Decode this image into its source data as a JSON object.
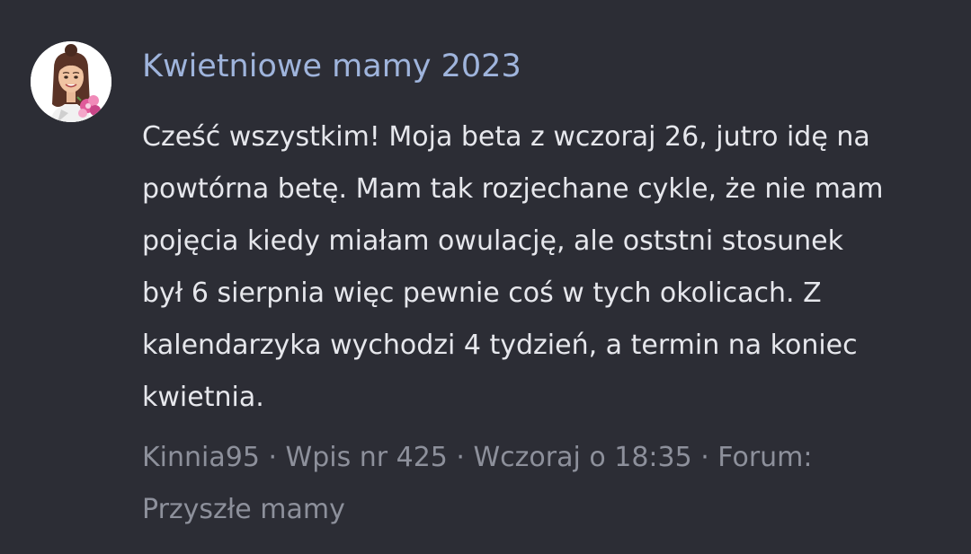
{
  "post": {
    "avatar_icon": "bitmoji-avatar-icon",
    "group_title": "Kwietniowe mamy 2023",
    "body_lines": [
      "Cześć wszystkim! Moja beta z wczoraj 26, jutro idę na",
      "powtórna betę. Mam tak rozjechane cykle, że nie mam",
      "pojęcia kiedy miałam owulację, ale oststni stosunek",
      "był 6 sierpnia więc pewnie coś w tych okolicach. Z",
      "kalendarzyka wychodzi 4 tydzień, a termin na koniec",
      "kwietnia."
    ],
    "meta_lines": [
      "Kinnia95 · Wpis nr 425 · Wczoraj o 18:35 · Forum:",
      "Przyszłe mamy"
    ]
  },
  "colors": {
    "background": "#2c2d35",
    "title": "#9fb4dc",
    "body_text": "#e6e7ec",
    "meta_text": "#8d909b"
  }
}
